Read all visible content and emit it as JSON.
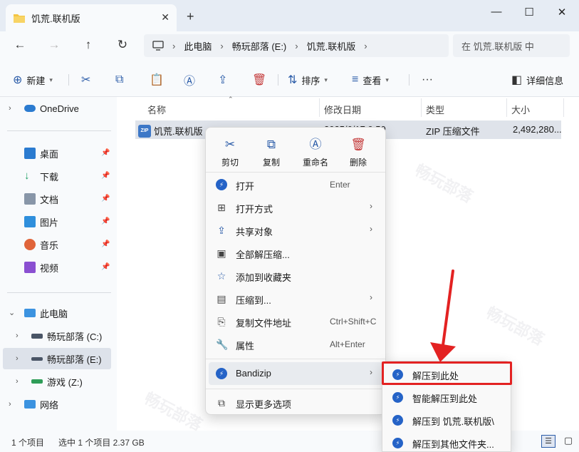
{
  "window": {
    "tab_title": "饥荒.联机版",
    "tab_close": "✕",
    "new_tab": "+",
    "minimize": "—",
    "maximize": "☐",
    "close": "✕"
  },
  "nav": {
    "back": "←",
    "forward": "→",
    "up": "↑",
    "refresh": "↻",
    "breadcrumb": [
      "此电脑",
      "畅玩部落 (E:)",
      "饥荒.联机版"
    ],
    "search_placeholder": "在 饥荒.联机版 中"
  },
  "toolbar": {
    "new_label": "新建",
    "sort_label": "排序",
    "view_label": "查看",
    "details_label": "详细信息"
  },
  "sidebar": {
    "onedrive": "OneDrive",
    "quick": [
      {
        "label": "桌面",
        "icon": "desktop-icon",
        "color": "#2b7bd0"
      },
      {
        "label": "下载",
        "icon": "download-icon",
        "color": "#1b9e62"
      },
      {
        "label": "文档",
        "icon": "document-icon",
        "color": "#6d7d92"
      },
      {
        "label": "图片",
        "icon": "pictures-icon",
        "color": "#2f8fdc"
      },
      {
        "label": "音乐",
        "icon": "music-icon",
        "color": "#e0643a"
      },
      {
        "label": "视频",
        "icon": "video-icon",
        "color": "#8a4fd1"
      }
    ],
    "this_pc": "此电脑",
    "drives": [
      "畅玩部落 (C:)",
      "畅玩部落 (E:)",
      "游戏 (Z:)"
    ],
    "network": "网络"
  },
  "columns": {
    "name": "名称",
    "modified": "修改日期",
    "type": "类型",
    "size": "大小"
  },
  "file": {
    "name": "饥荒.联机版",
    "modified": "2025/6/17 9:50",
    "type": "ZIP 压缩文件",
    "size": "2,492,280..."
  },
  "status": {
    "count": "1 个项目",
    "selected": "选中 1 个项目  2.37 GB"
  },
  "context_menu": {
    "quick_actions": [
      {
        "label": "剪切",
        "icon": "scissors-icon"
      },
      {
        "label": "复制",
        "icon": "copy-icon"
      },
      {
        "label": "重命名",
        "icon": "rename-icon"
      },
      {
        "label": "删除",
        "icon": "trash-icon"
      }
    ],
    "items": [
      {
        "label": "打开",
        "shortcut": "Enter"
      },
      {
        "label": "打开方式",
        "shortcut": ""
      },
      {
        "label": "共享对象",
        "shortcut": ""
      },
      {
        "label": "全部解压缩...",
        "shortcut": ""
      },
      {
        "label": "添加到收藏夹",
        "shortcut": ""
      },
      {
        "label": "压缩到...",
        "shortcut": ""
      },
      {
        "label": "复制文件地址",
        "shortcut": "Ctrl+Shift+C"
      },
      {
        "label": "属性",
        "shortcut": "Alt+Enter"
      }
    ],
    "bandizip": "Bandizip",
    "more_options": "显示更多选项"
  },
  "submenu": {
    "items": [
      "解压到此处",
      "智能解压到此处",
      "解压到 饥荒.联机版\\",
      "解压到其他文件夹..."
    ]
  },
  "colors": {
    "accent": "#2b5ca8",
    "highlight_red": "#e32222",
    "bandizip_blue": "#2563c7"
  }
}
